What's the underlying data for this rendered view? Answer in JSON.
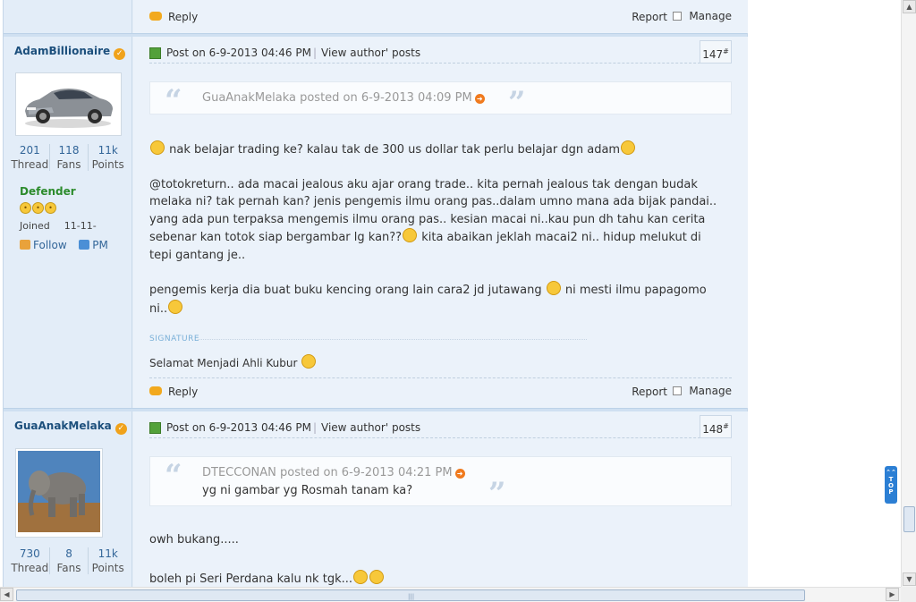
{
  "posts": [
    {
      "author": "AdamBillionaire",
      "stats": {
        "threads": "201",
        "fans": "118",
        "points": "11k"
      },
      "stat_labels": {
        "thread": "Thread",
        "fans": "Fans",
        "points": "Points"
      },
      "rank": "Defender",
      "joined_label": "Joined",
      "joined_value": "11-11-",
      "follow_label": "Follow",
      "pm_label": "PM",
      "post_time": "Post on 6-9-2013 04:46 PM",
      "view_author_posts": "View author' posts",
      "floor": "147",
      "quote": {
        "header": "GuaAnakMelaka posted on 6-9-2013 04:09 PM",
        "body": ""
      },
      "body": {
        "p1": "nak belajar trading ke? kalau tak de 300 us dollar tak perlu belajar dgn adam",
        "p2a": "@totokreturn.. ada macai jealous aku ajar orang trade.. kita pernah jealous tak dengan budak melaka ni? tak pernah kan? jenis pengemis ilmu orang pas..dalam umno mana ada bijak pandai.. yang ada pun terpaksa mengemis ilmu orang pas.. kesian macai ni..kau pun dh tahu kan cerita sebenar kan totok siap bergambar lg kan??",
        "p2b": " kita abaikan jeklah macai2 ni.. hidup melukut di tepi gantang je..",
        "p3a": "pengemis kerja dia buat buku kencing orang lain cara2 jd jutawang ",
        "p3b": "  ni mesti ilmu papagomo ni.."
      },
      "signature_label": "SIGNATURE",
      "signature": "Selamat Menjadi Ahli Kubur"
    },
    {
      "author": "GuaAnakMelaka",
      "stats": {
        "threads": "730",
        "fans": "8",
        "points": "11k"
      },
      "stat_labels": {
        "thread": "Thread",
        "fans": "Fans",
        "points": "Points"
      },
      "post_time": "Post on 6-9-2013 04:46 PM",
      "view_author_posts": "View author' posts",
      "floor": "148",
      "quote": {
        "header": "DTECCONAN posted on 6-9-2013 04:21 PM",
        "body": "yg ni gambar yg Rosmah tanam ka?"
      },
      "body": {
        "p1": "owh bukang.....",
        "p2": "boleh pi Seri Perdana kalu nk tgk..."
      }
    }
  ],
  "footer": {
    "reply": "Reply",
    "report": "Report",
    "manage": "Manage"
  },
  "floor_suffix": "#",
  "totop": "TOP",
  "icons": {
    "verify": "verified-badge-icon",
    "post": "post-icon",
    "quote_link": "goto-quote-icon",
    "reply": "reply-icon",
    "follow": "follow-icon",
    "pm": "pm-icon"
  },
  "colors": {
    "accent": "#336699",
    "rank": "#2c8b2c",
    "top_button": "#2c7fd4"
  }
}
